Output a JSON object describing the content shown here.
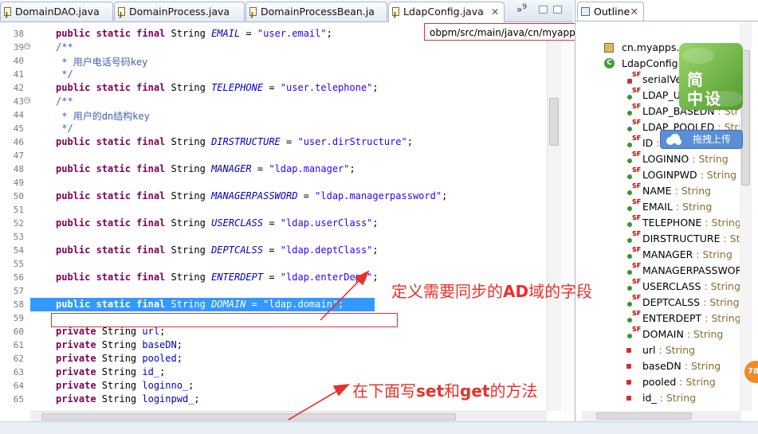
{
  "editor_tabs": [
    {
      "label": "DomainDAO.java",
      "active": false
    },
    {
      "label": "DomainProcess.java",
      "active": false
    },
    {
      "label": "DomainProcessBean.ja",
      "active": false
    },
    {
      "label": "LdapConfig.java",
      "active": true
    }
  ],
  "tab_close_glyph": "✕",
  "tab_overflow": {
    "symbol": "»",
    "count": "9"
  },
  "path_tooltip": "obpm/src/main/java/cn/myapps/core/sysconfig/ejb/LdapConfig.java",
  "code_lines": [
    {
      "num": "38",
      "fold": false,
      "selected": false,
      "parts": [
        [
          "kw",
          "public static final "
        ],
        [
          "plain",
          "String "
        ],
        [
          "fld",
          "EMAIL"
        ],
        [
          "plain",
          " = "
        ],
        [
          "str",
          "\"user.email\""
        ],
        [
          "plain",
          ";"
        ]
      ]
    },
    {
      "num": "39",
      "fold": true,
      "selected": false,
      "parts": [
        [
          "cmt",
          "/**"
        ]
      ]
    },
    {
      "num": "40",
      "fold": false,
      "selected": false,
      "parts": [
        [
          "cmt",
          " * "
        ],
        [
          "cmt-cn",
          "用户电话号码"
        ],
        [
          "cmt",
          "key"
        ]
      ]
    },
    {
      "num": "41",
      "fold": false,
      "selected": false,
      "parts": [
        [
          "cmt",
          " */"
        ]
      ]
    },
    {
      "num": "42",
      "fold": false,
      "selected": false,
      "parts": [
        [
          "kw",
          "public static final "
        ],
        [
          "plain",
          "String "
        ],
        [
          "fld",
          "TELEPHONE"
        ],
        [
          "plain",
          " = "
        ],
        [
          "str",
          "\"user.telephone\""
        ],
        [
          "plain",
          ";"
        ]
      ]
    },
    {
      "num": "43",
      "fold": true,
      "selected": false,
      "parts": [
        [
          "cmt",
          "/**"
        ]
      ]
    },
    {
      "num": "44",
      "fold": false,
      "selected": false,
      "parts": [
        [
          "cmt",
          " * "
        ],
        [
          "cmt-cn",
          "用户的"
        ],
        [
          "cmt",
          "dn"
        ],
        [
          "cmt-cn",
          "结构"
        ],
        [
          "cmt",
          "key"
        ]
      ]
    },
    {
      "num": "45",
      "fold": false,
      "selected": false,
      "parts": [
        [
          "cmt",
          " */"
        ]
      ]
    },
    {
      "num": "46",
      "fold": false,
      "selected": false,
      "parts": [
        [
          "kw",
          "public static final "
        ],
        [
          "plain",
          "String "
        ],
        [
          "fld",
          "DIRSTRUCTURE"
        ],
        [
          "plain",
          " = "
        ],
        [
          "str",
          "\"user.dirStructure\""
        ],
        [
          "plain",
          ";"
        ]
      ]
    },
    {
      "num": "47",
      "fold": false,
      "selected": false,
      "parts": []
    },
    {
      "num": "48",
      "fold": false,
      "selected": false,
      "parts": [
        [
          "kw",
          "public static final "
        ],
        [
          "plain",
          "String "
        ],
        [
          "fld",
          "MANAGER"
        ],
        [
          "plain",
          " = "
        ],
        [
          "str",
          "\"ldap.manager\""
        ],
        [
          "plain",
          ";"
        ]
      ]
    },
    {
      "num": "49",
      "fold": false,
      "selected": false,
      "parts": []
    },
    {
      "num": "50",
      "fold": false,
      "selected": false,
      "parts": [
        [
          "kw",
          "public static final "
        ],
        [
          "plain",
          "String "
        ],
        [
          "fld",
          "MANAGERPASSWORD"
        ],
        [
          "plain",
          " = "
        ],
        [
          "str",
          "\"ldap.managerpassword\""
        ],
        [
          "plain",
          ";"
        ]
      ]
    },
    {
      "num": "51",
      "fold": false,
      "selected": false,
      "parts": []
    },
    {
      "num": "52",
      "fold": false,
      "selected": false,
      "parts": [
        [
          "kw",
          "public static final "
        ],
        [
          "plain",
          "String "
        ],
        [
          "fld",
          "USERCLASS"
        ],
        [
          "plain",
          " = "
        ],
        [
          "str",
          "\"ldap.userClass\""
        ],
        [
          "plain",
          ";"
        ]
      ]
    },
    {
      "num": "53",
      "fold": false,
      "selected": false,
      "parts": []
    },
    {
      "num": "54",
      "fold": false,
      "selected": false,
      "parts": [
        [
          "kw",
          "public static final "
        ],
        [
          "plain",
          "String "
        ],
        [
          "fld",
          "DEPTCALSS"
        ],
        [
          "plain",
          " = "
        ],
        [
          "str",
          "\"ldap.deptClass\""
        ],
        [
          "plain",
          ";"
        ]
      ]
    },
    {
      "num": "55",
      "fold": false,
      "selected": false,
      "parts": []
    },
    {
      "num": "56",
      "fold": false,
      "selected": false,
      "parts": [
        [
          "kw",
          "public static final "
        ],
        [
          "plain",
          "String "
        ],
        [
          "fld",
          "ENTERDEPT"
        ],
        [
          "plain",
          " = "
        ],
        [
          "str",
          "\"ldap.enterDept\""
        ],
        [
          "plain",
          ";"
        ]
      ]
    },
    {
      "num": "57",
      "fold": false,
      "selected": false,
      "parts": []
    },
    {
      "num": "58",
      "fold": false,
      "selected": true,
      "parts": [
        [
          "kw",
          "public static final "
        ],
        [
          "plain",
          "String "
        ],
        [
          "fld",
          "DOMAIN"
        ],
        [
          "plain",
          " = "
        ],
        [
          "str",
          "\"ldap.domain\""
        ],
        [
          "plain",
          ";"
        ]
      ]
    },
    {
      "num": "59",
      "fold": false,
      "selected": false,
      "parts": []
    },
    {
      "num": "60",
      "fold": false,
      "selected": false,
      "parts": [
        [
          "kw",
          "private "
        ],
        [
          "plain",
          "String "
        ],
        [
          "pfld",
          "url"
        ],
        [
          "plain",
          ";"
        ]
      ]
    },
    {
      "num": "61",
      "fold": false,
      "selected": false,
      "parts": [
        [
          "kw",
          "private "
        ],
        [
          "plain",
          "String "
        ],
        [
          "pfld",
          "baseDN"
        ],
        [
          "plain",
          ";"
        ]
      ]
    },
    {
      "num": "62",
      "fold": false,
      "selected": false,
      "parts": [
        [
          "kw",
          "private "
        ],
        [
          "plain",
          "String "
        ],
        [
          "pfld",
          "pooled"
        ],
        [
          "plain",
          ";"
        ]
      ]
    },
    {
      "num": "63",
      "fold": false,
      "selected": false,
      "parts": [
        [
          "kw",
          "private "
        ],
        [
          "plain",
          "String "
        ],
        [
          "pfld",
          "id_"
        ],
        [
          "plain",
          ";"
        ]
      ]
    },
    {
      "num": "64",
      "fold": false,
      "selected": false,
      "parts": [
        [
          "kw",
          "private "
        ],
        [
          "plain",
          "String "
        ],
        [
          "pfld",
          "loginno_"
        ],
        [
          "plain",
          ";"
        ]
      ]
    },
    {
      "num": "65",
      "fold": false,
      "selected": false,
      "parts": [
        [
          "kw",
          "private "
        ],
        [
          "plain",
          "String "
        ],
        [
          "pfld",
          "loginpwd_"
        ],
        [
          "plain",
          ";"
        ]
      ]
    }
  ],
  "outline": {
    "tab_label": "Outline",
    "items": [
      {
        "kind": "pkg",
        "name": "cn.myapps.c",
        "type": ""
      },
      {
        "kind": "class",
        "name": "LdapConfig",
        "type": ""
      },
      {
        "kind": "sf-red",
        "name": "serialVe",
        "type": ""
      },
      {
        "kind": "sf",
        "name": "LDAP_UI",
        "type": ""
      },
      {
        "kind": "sf",
        "name": "LDAP_BASEDN",
        "type": " : Strin"
      },
      {
        "kind": "sf",
        "name": "LDAP_POOLED",
        "type": " : Strin"
      },
      {
        "kind": "sf",
        "name": "ID",
        "type": " :"
      },
      {
        "kind": "sf",
        "name": "LOGINNO",
        "type": " : String"
      },
      {
        "kind": "sf",
        "name": "LOGINPWD",
        "type": " : String"
      },
      {
        "kind": "sf",
        "name": "NAME",
        "type": " : String"
      },
      {
        "kind": "sf",
        "name": "EMAIL",
        "type": " : String"
      },
      {
        "kind": "sf",
        "name": "TELEPHONE",
        "type": " : String"
      },
      {
        "kind": "sf",
        "name": "DIRSTRUCTURE",
        "type": " : Stri"
      },
      {
        "kind": "sf",
        "name": "MANAGER",
        "type": " : String"
      },
      {
        "kind": "sf",
        "name": "MANAGERPASSWOR",
        "type": ""
      },
      {
        "kind": "sf",
        "name": "USERCLASS",
        "type": " : String"
      },
      {
        "kind": "sf",
        "name": "DEPTCALSS",
        "type": " : String"
      },
      {
        "kind": "sf",
        "name": "ENTERDEPT",
        "type": " : String"
      },
      {
        "kind": "sf",
        "name": "DOMAIN",
        "type": " : String"
      },
      {
        "kind": "priv",
        "name": "url",
        "type": " : String"
      },
      {
        "kind": "priv",
        "name": "baseDN",
        "type": " : String"
      },
      {
        "kind": "priv",
        "name": "pooled",
        "type": " : String"
      },
      {
        "kind": "priv",
        "name": "id_",
        "type": " : String"
      }
    ]
  },
  "overlays": {
    "logo_line1": "简",
    "logo_line2": "中设",
    "upload_label": "拖拽上传",
    "badge": "78"
  },
  "annotations": {
    "top_pre": "定义需要同步的",
    "top_bold": "AD",
    "top_post": "域的字段",
    "bottom_pre": "在下面写",
    "bottom_b1": "set",
    "bottom_mid": "和",
    "bottom_b2": "get",
    "bottom_post": "的方法"
  },
  "colors": {
    "keyword": "#7f0055",
    "field": "#0000c0",
    "string": "#2a00ff",
    "comment": "#3f5fbf",
    "selection": "#3399ff",
    "annotation": "#e8312b"
  }
}
